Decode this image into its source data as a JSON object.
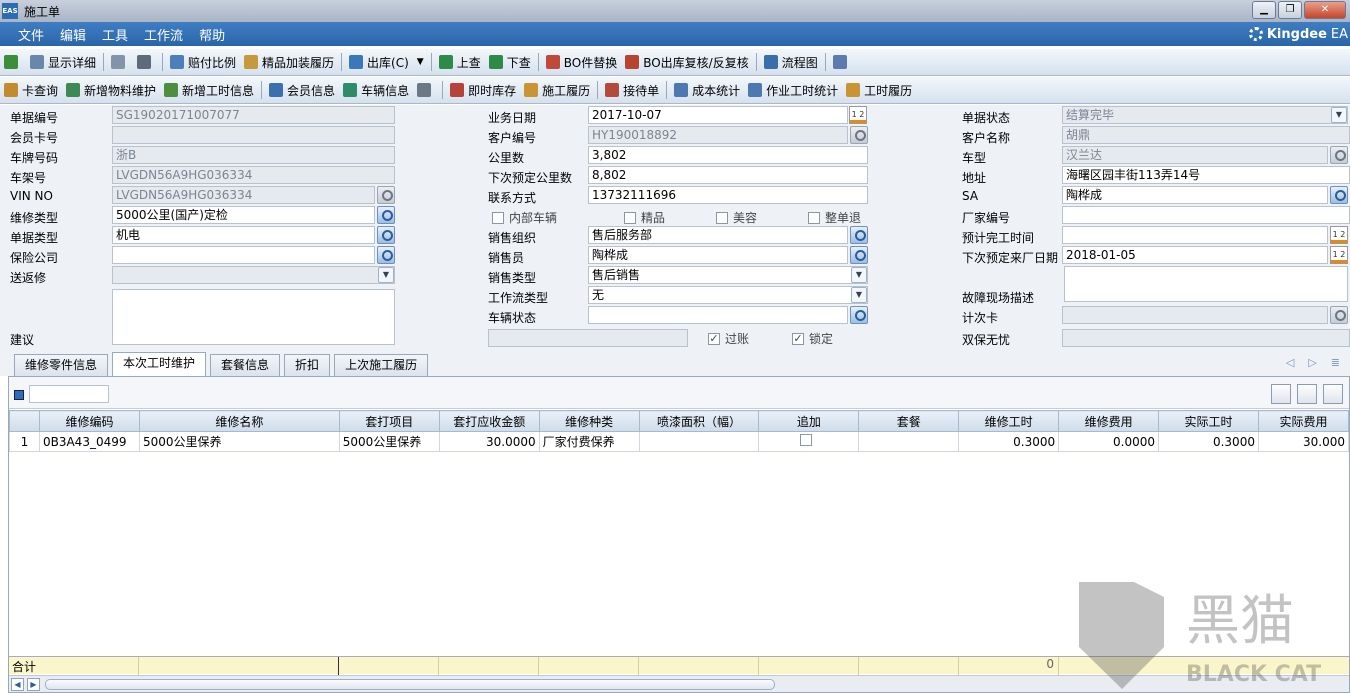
{
  "window": {
    "title": "施工单",
    "app_icon": "EAS"
  },
  "menu": {
    "items": [
      "文件",
      "编辑",
      "工具",
      "工作流",
      "帮助"
    ],
    "brand": "Kingdee",
    "brand_suffix": "EA"
  },
  "toolbar1": [
    "显示详细",
    "",
    "",
    "赔付比例",
    "精品加装履历",
    "出库(C)",
    "上查",
    "下查",
    "BO件替换",
    "BO出库复核/反复核",
    "流程图",
    ""
  ],
  "toolbar2": [
    "卡查询",
    "新增物料维护",
    "新增工时信息",
    "会员信息",
    "车辆信息",
    "",
    "即时库存",
    "施工履历",
    "接待单",
    "成本统计",
    "作业工时统计",
    "工时履历"
  ],
  "form": {
    "col1": [
      {
        "label": "单据编号",
        "value": "SG19020171007077"
      },
      {
        "label": "会员卡号",
        "value": ""
      },
      {
        "label": "车牌号码",
        "value": "浙B"
      },
      {
        "label": "车架号",
        "value": "LVGDN56A9HG036334"
      },
      {
        "label": "VIN NO",
        "value": "LVGDN56A9HG036334"
      },
      {
        "label": "维修类型",
        "value": "5000公里(国产)定检"
      },
      {
        "label": "单据类型",
        "value": "机电"
      },
      {
        "label": "保险公司",
        "value": ""
      },
      {
        "label": "送返修",
        "value": ""
      },
      {
        "label": "建议",
        "value": ""
      }
    ],
    "col2": [
      {
        "label": "业务日期",
        "value": "2017-10-07"
      },
      {
        "label": "客户编号",
        "value": "HY190018892"
      },
      {
        "label": "公里数",
        "value": "3,802"
      },
      {
        "label": "下次预定公里数",
        "value": "8,802"
      },
      {
        "label": "联系方式",
        "value": "13732111696"
      },
      {
        "label": "销售组织",
        "value": "售后服务部"
      },
      {
        "label": "销售员",
        "value": "陶桦成"
      },
      {
        "label": "销售类型",
        "value": "售后销售"
      },
      {
        "label": "工作流类型",
        "value": "无"
      },
      {
        "label": "车辆状态",
        "value": ""
      }
    ],
    "checks": [
      {
        "label": "内部车辆",
        "checked": false
      },
      {
        "label": "精品",
        "checked": false
      },
      {
        "label": "美容",
        "checked": false
      },
      {
        "label": "整单退",
        "checked": false
      }
    ],
    "checks2": [
      {
        "label": "过账",
        "checked": true
      },
      {
        "label": "锁定",
        "checked": true
      }
    ],
    "col3": [
      {
        "label": "单据状态",
        "value": "结算完毕"
      },
      {
        "label": "客户名称",
        "value": "胡鼎"
      },
      {
        "label": "车型",
        "value": "汉兰达"
      },
      {
        "label": "地址",
        "value": "海曙区园丰街113弄14号"
      },
      {
        "label": "SA",
        "value": "陶桦成"
      },
      {
        "label": "厂家编号",
        "value": ""
      },
      {
        "label": "预计完工时间",
        "value": ""
      },
      {
        "label": "下次预定来厂日期",
        "value": "2018-01-05"
      },
      {
        "label": "故障现场描述",
        "value": ""
      },
      {
        "label": "计次卡",
        "value": ""
      },
      {
        "label": "双保无忧",
        "value": ""
      }
    ],
    "cal_label": "1 2"
  },
  "tabs": [
    "维修零件信息",
    "本次工时维护",
    "套餐信息",
    "折扣",
    "上次施工履历"
  ],
  "table": {
    "headers": [
      "维修编码",
      "维修名称",
      "套打项目",
      "套打应收金额",
      "维修种类",
      "喷漆面积（幅）",
      "追加",
      "套餐",
      "维修工时",
      "维修费用",
      "实际工时",
      "实际费用"
    ],
    "rows": [
      {
        "index": "1",
        "cells": [
          "0B3A43_0499",
          "5000公里保养",
          "5000公里保养",
          "30.0000",
          "厂家付费保养",
          "",
          "",
          "",
          "0.3000",
          "0.0000",
          "0.3000",
          "30.000"
        ]
      }
    ],
    "footer_label": "合计",
    "footer_value": "0"
  },
  "watermark": {
    "text": "黑猫",
    "sub": "BLACK CAT"
  }
}
